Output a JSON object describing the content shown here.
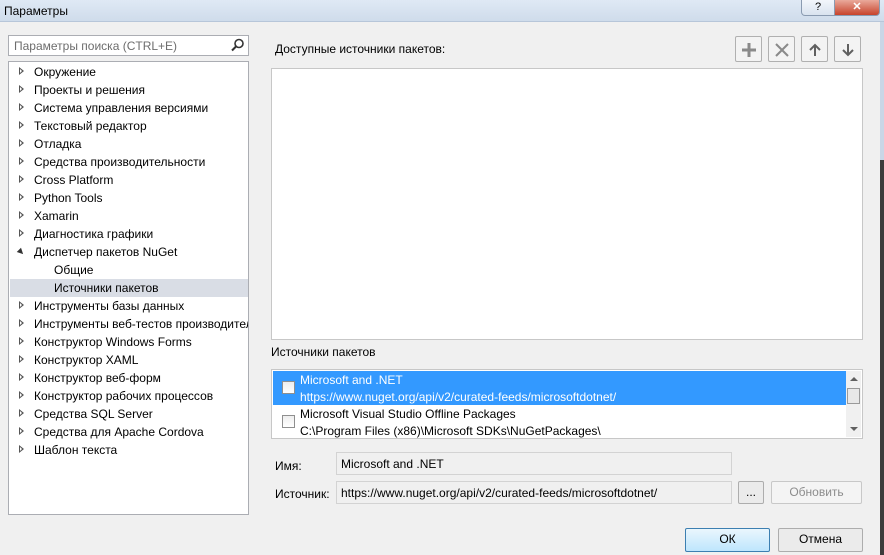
{
  "window": {
    "title": "Параметры",
    "help_label": "?",
    "close_label": "✕"
  },
  "search": {
    "placeholder": "Параметры поиска (CTRL+E)"
  },
  "tree": {
    "items": [
      {
        "label": "Окружение",
        "state": "closed"
      },
      {
        "label": "Проекты и решения",
        "state": "closed"
      },
      {
        "label": "Система управления версиями",
        "state": "closed"
      },
      {
        "label": "Текстовый редактор",
        "state": "closed"
      },
      {
        "label": "Отладка",
        "state": "closed"
      },
      {
        "label": "Средства производительности",
        "state": "closed"
      },
      {
        "label": "Cross Platform",
        "state": "closed"
      },
      {
        "label": "Python Tools",
        "state": "closed"
      },
      {
        "label": "Xamarin",
        "state": "closed"
      },
      {
        "label": "Диагностика графики",
        "state": "closed"
      },
      {
        "label": "Диспетчер пакетов NuGet",
        "state": "open"
      },
      {
        "label": "Общие",
        "state": "child"
      },
      {
        "label": "Источники пакетов",
        "state": "child-selected"
      },
      {
        "label": "Инструменты базы данных",
        "state": "closed"
      },
      {
        "label": "Инструменты веб-тестов производителя",
        "state": "closed"
      },
      {
        "label": "Конструктор Windows Forms",
        "state": "closed"
      },
      {
        "label": "Конструктор XAML",
        "state": "closed"
      },
      {
        "label": "Конструктор веб-форм",
        "state": "closed"
      },
      {
        "label": "Конструктор рабочих процессов",
        "state": "closed"
      },
      {
        "label": "Средства SQL Server",
        "state": "closed"
      },
      {
        "label": "Средства для Apache Cordova",
        "state": "closed"
      },
      {
        "label": "Шаблон текста",
        "state": "closed"
      }
    ]
  },
  "main": {
    "available_label": "Доступные источники пакетов:",
    "toolbar_icons": [
      "plus-icon",
      "x-icon",
      "arrow-up-icon",
      "arrow-down-icon"
    ],
    "sources_label": "Источники пакетов",
    "sources": [
      {
        "name": "Microsoft and .NET",
        "url": "https://www.nuget.org/api/v2/curated-feeds/microsoftdotnet/",
        "checked": false,
        "selected": true
      },
      {
        "name": "Microsoft Visual Studio Offline Packages",
        "url": "C:\\Program Files (x86)\\Microsoft SDKs\\NuGetPackages\\",
        "checked": false,
        "selected": false
      }
    ],
    "name_label": "Имя:",
    "name_value": "Microsoft and .NET",
    "source_label": "Источник:",
    "source_value": "https://www.nuget.org/api/v2/curated-feeds/microsoftdotnet/",
    "browse_label": "...",
    "update_label": "Обновить"
  },
  "footer": {
    "ok_label": "ОК",
    "cancel_label": "Отмена"
  },
  "colors": {
    "selection": "#3399ff",
    "tree_selection": "#d9dde5"
  }
}
